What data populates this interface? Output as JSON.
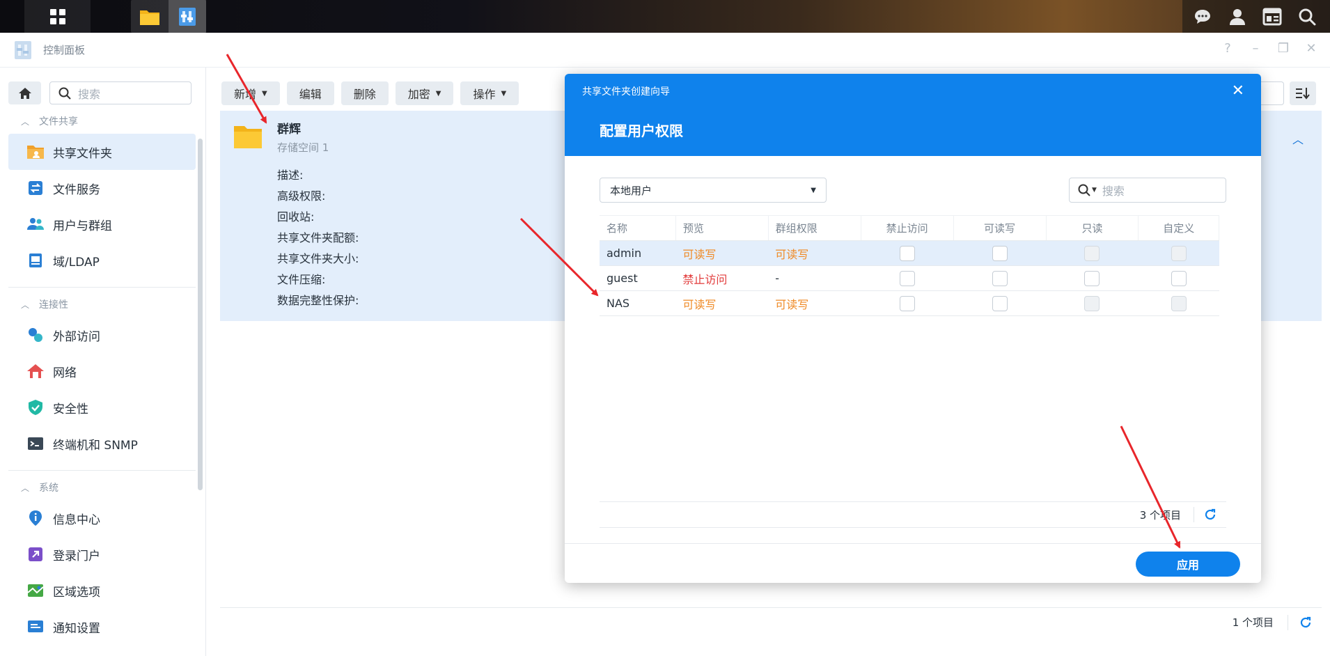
{
  "window": {
    "title": "控制面板"
  },
  "sidebar": {
    "search_placeholder": "搜索",
    "groups": [
      {
        "header": "文件共享",
        "items": [
          "共享文件夹",
          "文件服务",
          "用户与群组",
          "域/LDAP"
        ]
      },
      {
        "header": "连接性",
        "items": [
          "外部访问",
          "网络",
          "安全性",
          "终端机和 SNMP"
        ]
      },
      {
        "header": "系统",
        "items": [
          "信息中心",
          "登录门户",
          "区域选项",
          "通知设置"
        ]
      }
    ]
  },
  "toolbar": {
    "new": "新增",
    "edit": "编辑",
    "delete": "删除",
    "encrypt": "加密",
    "action": "操作"
  },
  "folder": {
    "name": "群辉",
    "storage": "存储空间 1",
    "props": [
      "描述:",
      "高级权限:",
      "回收站:",
      "共享文件夹配额:",
      "共享文件夹大小:",
      "文件压缩:",
      "数据完整性保护:"
    ]
  },
  "main_footer": {
    "count": "1 个项目"
  },
  "dialog": {
    "wizard_title": "共享文件夹创建向导",
    "title": "配置用户权限",
    "select_value": "本地用户",
    "search_placeholder": "搜索",
    "columns": [
      "名称",
      "预览",
      "群组权限",
      "禁止访问",
      "可读写",
      "只读",
      "自定义"
    ],
    "rows": [
      {
        "name": "admin",
        "preview": "可读写",
        "group": "可读写",
        "selected": true,
        "preview_color": "orange",
        "group_color": "orange"
      },
      {
        "name": "guest",
        "preview": "禁止访问",
        "group": "-",
        "selected": false,
        "preview_color": "red",
        "group_color": "none"
      },
      {
        "name": "NAS",
        "preview": "可读写",
        "group": "可读写",
        "selected": false,
        "preview_color": "orange",
        "group_color": "orange"
      }
    ],
    "count": "3 个项目",
    "apply": "应用"
  },
  "colors": {
    "accent": "#0f82ec",
    "orange": "#ef8a25",
    "red": "#e23b3b",
    "selected_bg": "#e3eefb",
    "annotation_arrow": "#e8262b"
  }
}
